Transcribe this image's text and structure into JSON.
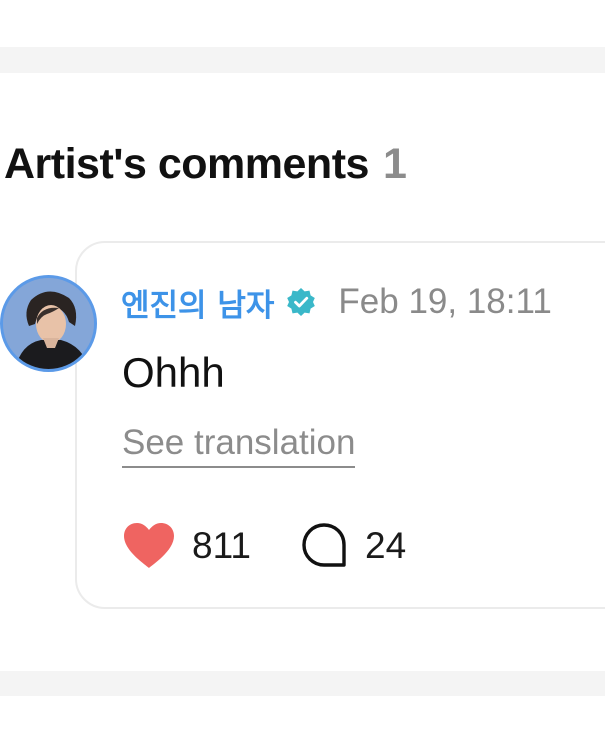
{
  "section": {
    "title": "Artist's comments",
    "count": "1"
  },
  "comment": {
    "author": "엔진의 남자",
    "timestamp": "Feb 19, 18:11",
    "text": "Ohhh",
    "translate_label": "See translation",
    "likes": "811",
    "replies": "24",
    "verified_icon": "verified-badge-icon",
    "like_icon": "heart-icon",
    "reply_icon": "speech-bubble-icon"
  },
  "colors": {
    "author_name": "#3d93e8",
    "verified_badge": "#3ab8c9",
    "heart": "#ef6461",
    "divider": "#f4f4f4",
    "card_border": "#ebebeb"
  }
}
